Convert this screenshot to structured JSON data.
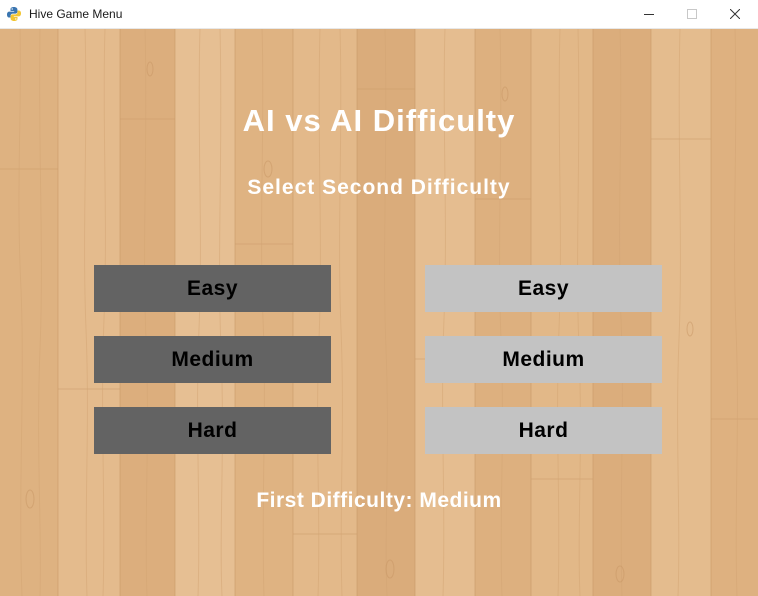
{
  "window": {
    "title": "Hive Game Menu"
  },
  "menu": {
    "heading": "AI vs AI Difficulty",
    "subheading": "Select Second Difficulty",
    "first_column": [
      {
        "label": "Easy"
      },
      {
        "label": "Medium"
      },
      {
        "label": "Hard"
      }
    ],
    "second_column": [
      {
        "label": "Easy"
      },
      {
        "label": "Medium"
      },
      {
        "label": "Hard"
      }
    ],
    "footer": "First Difficulty: Medium"
  },
  "colors": {
    "wood": "#e0b483",
    "dark_button": "#636363",
    "light_button": "#c3c3c3",
    "text_light": "#ffffff",
    "text_dark": "#000000"
  },
  "icons": {
    "app": "python-snake-icon",
    "minimize": "minimize-icon",
    "maximize": "maximize-icon",
    "close": "close-icon"
  }
}
